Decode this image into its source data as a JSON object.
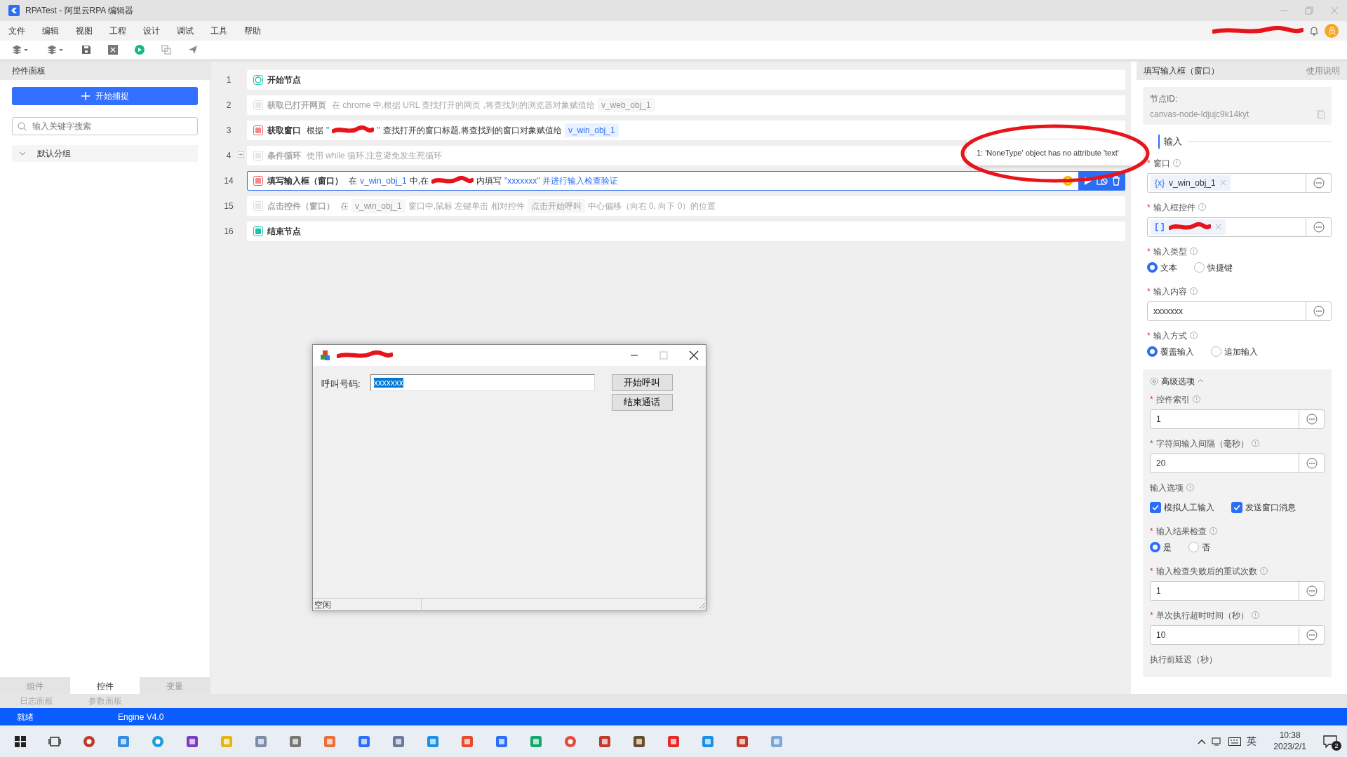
{
  "window": {
    "title": "RPATest - 阿里云RPA 编辑器"
  },
  "menu": [
    "文件",
    "编辑",
    "视图",
    "工程",
    "设计",
    "调试",
    "工具",
    "帮助"
  ],
  "user": {
    "avatar": "员",
    "name": {
      "kind": "redacted"
    }
  },
  "left_panel": {
    "title": "控件面板",
    "capture_button": "开始捕捉",
    "search": {
      "placeholder": "输入关键字搜索"
    },
    "groups": [
      {
        "label": "默认分组",
        "expanded": true
      }
    ]
  },
  "left_tabs": [
    {
      "label": "组件",
      "selected": false
    },
    {
      "label": "控件",
      "selected": true
    },
    {
      "label": "变量",
      "selected": false
    }
  ],
  "panel_tabs": [
    "日志面板",
    "参数面板"
  ],
  "steps": [
    {
      "line": "1",
      "kind": "start",
      "title": "开始节点",
      "disabled": false,
      "selected": false
    },
    {
      "line": "2",
      "kind": "action",
      "title": "获取已打开网页",
      "disabled": true,
      "selected": false,
      "parts": [
        {
          "kind": "text",
          "text": "在 chrome 中,根据 URL 查找打开的网页 ,将查找到的浏览器对象赋值给"
        },
        {
          "kind": "var",
          "text": "v_web_obj_1"
        }
      ]
    },
    {
      "line": "3",
      "kind": "action",
      "title": "获取窗口",
      "disabled": false,
      "selected": false,
      "parts": [
        {
          "kind": "text",
          "text": "根据"
        },
        {
          "kind": "string",
          "text": "\""
        },
        {
          "kind": "redacted"
        },
        {
          "kind": "string",
          "text": "\""
        },
        {
          "kind": "text",
          "text": "查找打开的窗口标题,将查找到的窗口对象赋值给"
        },
        {
          "kind": "var",
          "text": "v_win_obj_1"
        }
      ]
    },
    {
      "line": "4",
      "kind": "loop",
      "title": "条件循环",
      "disabled": true,
      "selected": false,
      "expanded": false,
      "parts": [
        {
          "kind": "text",
          "text": "使用 while 循环,注意避免发生死循环"
        }
      ]
    },
    {
      "line": "14",
      "kind": "action",
      "title": "填写输入框（窗口）",
      "disabled": false,
      "selected": true,
      "warning": true,
      "parts": [
        {
          "kind": "text",
          "text": "在"
        },
        {
          "kind": "string",
          "text": "v_win_obj_1"
        },
        {
          "kind": "text",
          "text": "中,在"
        },
        {
          "kind": "redacted"
        },
        {
          "kind": "text",
          "text": "内填写"
        },
        {
          "kind": "string",
          "text": "\"xxxxxxx\" 并进行输入检查验证"
        }
      ]
    },
    {
      "line": "15",
      "kind": "action",
      "title": "点击控件（窗口）",
      "disabled": true,
      "selected": false,
      "parts": [
        {
          "kind": "text",
          "text": "在"
        },
        {
          "kind": "var",
          "text": "v_win_obj_1"
        },
        {
          "kind": "text",
          "text": "窗口中,鼠标 左键单击 相对控件"
        },
        {
          "kind": "var",
          "text": "点击开始呼叫"
        },
        {
          "kind": "text",
          "text": "中心偏移（向右 0, 向下 0）的位置"
        }
      ]
    },
    {
      "line": "16",
      "kind": "end",
      "title": "结束节点",
      "disabled": false,
      "selected": false
    }
  ],
  "error_tooltip": "1: 'NoneType' object has no attribute 'text'",
  "properties": {
    "title": "填写输入框（窗口）",
    "help_link": "使用说明",
    "node_id_label": "节点ID:",
    "node_id": "canvas-node-ldjujc9k14kyt",
    "section": "输入",
    "fields": [
      {
        "kind": "chip",
        "marker": "*",
        "label": "窗口",
        "prefix": "{x}",
        "value": "v_win_obj_1"
      },
      {
        "kind": "element",
        "marker": "*",
        "label": "输入框控件",
        "value": {
          "kind": "redacted"
        }
      },
      {
        "kind": "radio",
        "marker": "*",
        "label": "输入类型",
        "options": [
          {
            "label": "文本",
            "selected": true
          },
          {
            "label": "快捷键",
            "selected": false
          }
        ]
      },
      {
        "kind": "input",
        "marker": "*",
        "label": "输入内容",
        "value": "xxxxxxx"
      },
      {
        "kind": "radio",
        "marker": "*",
        "label": "输入方式",
        "options": [
          {
            "label": "覆盖输入",
            "selected": true
          },
          {
            "label": "追加输入",
            "selected": false
          }
        ]
      }
    ],
    "advanced": {
      "label": "高级选项",
      "expanded": true,
      "fields": [
        {
          "kind": "input",
          "marker": "*",
          "label": "控件索引",
          "value": "1"
        },
        {
          "kind": "input",
          "marker": "*",
          "label": "字符间输入间隔（毫秒）",
          "value": "20"
        },
        {
          "kind": "checks",
          "label": "输入选项",
          "options": [
            {
              "label": "模拟人工输入",
              "checked": true
            },
            {
              "label": "发送窗口消息",
              "checked": true
            }
          ]
        },
        {
          "kind": "radio",
          "marker": "*",
          "label": "输入结果检查",
          "options": [
            {
              "label": "是",
              "selected": true
            },
            {
              "label": "否",
              "selected": false
            }
          ]
        },
        {
          "kind": "input",
          "marker": "*",
          "label": "输入检查失败后的重试次数",
          "value": "1"
        },
        {
          "kind": "input",
          "marker": "*",
          "label": "单次执行超时时间（秒）",
          "value": "10"
        },
        {
          "kind": "label",
          "label": "执行前延迟（秒）"
        }
      ]
    }
  },
  "dialog": {
    "title": {
      "kind": "redacted"
    },
    "field_label": "呼叫号码:",
    "field_value": "xxxxxxx",
    "value_selected": true,
    "buttons": [
      "开始呼叫",
      "结束通话"
    ],
    "status": "空闲"
  },
  "status_bar": {
    "state": "就绪",
    "engine": "Engine V4.0"
  },
  "taskbar": {
    "ime": "英",
    "time": "10:38",
    "date": "2023/2/1",
    "notifications": "2"
  }
}
